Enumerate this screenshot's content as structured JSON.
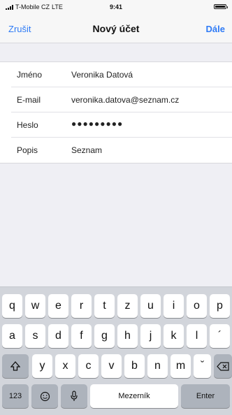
{
  "status_bar": {
    "carrier": "T-Mobile CZ",
    "network": "LTE",
    "time": "9:41"
  },
  "nav": {
    "cancel": "Zrušit",
    "title": "Nový účet",
    "next": "Dále"
  },
  "form": {
    "rows": [
      {
        "label": "Jméno",
        "value": "Veronika Datová"
      },
      {
        "label": "E-mail",
        "value": "veronika.datova@seznam.cz"
      },
      {
        "label": "Heslo",
        "value": "●●●●●●●●●"
      },
      {
        "label": "Popis",
        "value": "Seznam"
      }
    ]
  },
  "keyboard": {
    "row1": [
      "q",
      "w",
      "e",
      "r",
      "t",
      "z",
      "u",
      "i",
      "o",
      "p"
    ],
    "row2": [
      "a",
      "s",
      "d",
      "f",
      "g",
      "h",
      "j",
      "k",
      "l",
      "´"
    ],
    "row3": [
      "y",
      "x",
      "c",
      "v",
      "b",
      "n",
      "m",
      "ˇ"
    ],
    "numbers_key": "123",
    "space_key": "Mezerník",
    "enter_key": "Enter",
    "icons": {
      "shift": "shift-icon",
      "delete": "delete-icon",
      "emoji": "emoji-icon",
      "mic": "mic-icon"
    }
  }
}
